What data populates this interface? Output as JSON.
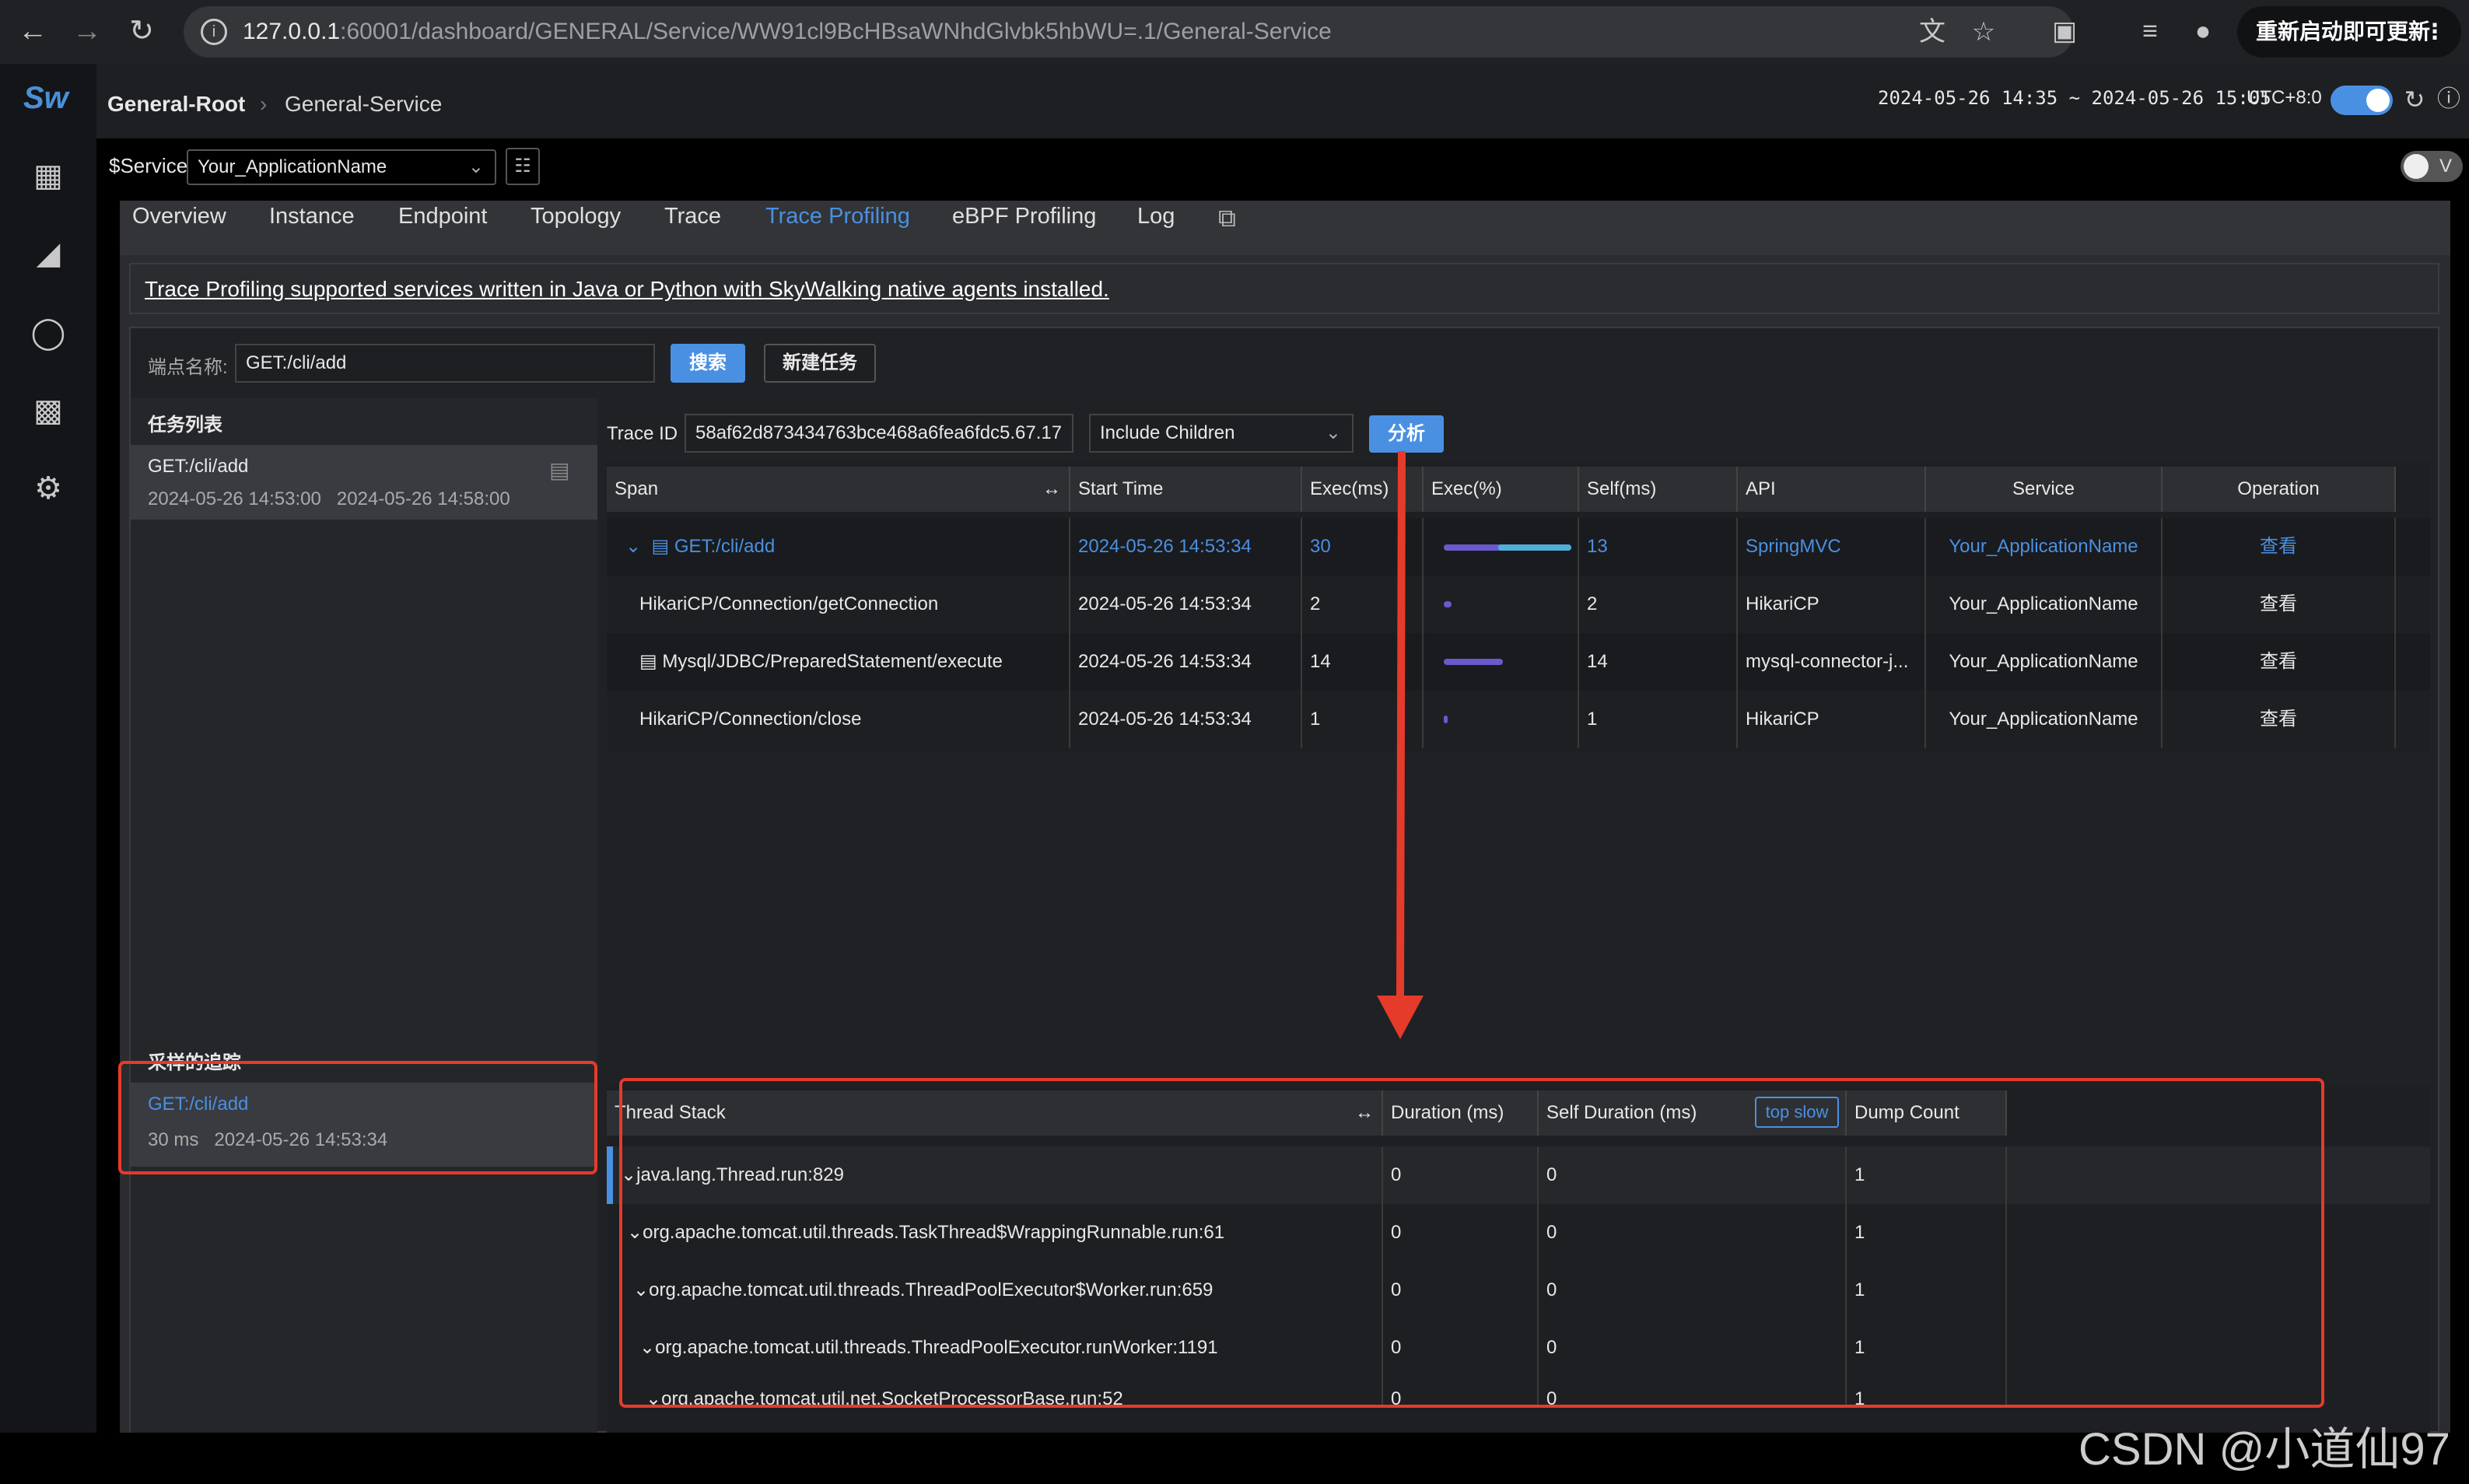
{
  "browser": {
    "url_host": "127.0.0.1",
    "url_rest": ":60001/dashboard/GENERAL/Service/WW91cl9BcHBsaWNhdGlvbk5hbWU=.1/General-Service",
    "update_button": "重新启动即可更新"
  },
  "header": {
    "logo": "Sw",
    "breadcrumb_root": "General-Root",
    "breadcrumb_current": "General-Service",
    "time_range": "2024-05-26 14:35 ~ 2024-05-26 15:05",
    "timezone": "UTC+8:0"
  },
  "service_bar": {
    "label": "$Service",
    "selected": "Your_ApplicationName",
    "toggle_label": "V"
  },
  "tabs": [
    "Overview",
    "Instance",
    "Endpoint",
    "Topology",
    "Trace",
    "Trace Profiling",
    "eBPF Profiling",
    "Log"
  ],
  "active_tab": "Trace Profiling",
  "notice": "Trace Profiling supported services written in Java or Python with SkyWalking native agents installed.",
  "search": {
    "label": "端点名称:",
    "value": "GET:/cli/add",
    "search_button": "搜索",
    "new_task_button": "新建任务"
  },
  "task_list": {
    "title": "任务列表",
    "items": [
      {
        "name": "GET:/cli/add",
        "start": "2024-05-26 14:53:00",
        "end": "2024-05-26 14:58:00"
      }
    ]
  },
  "sampled": {
    "title": "采样的追踪",
    "items": [
      {
        "name": "GET:/cli/add",
        "duration": "30 ms",
        "time": "2024-05-26 14:53:34"
      }
    ]
  },
  "trace_controls": {
    "trace_id_label": "Trace ID",
    "trace_id": "58af62d873434763bce468a6fea6fdc5.67.17",
    "children_option": "Include Children",
    "analyze_button": "分析"
  },
  "span_table": {
    "headers": [
      "Span",
      "Start Time",
      "Exec(ms)",
      "Exec(%)",
      "Self(ms)",
      "API",
      "Service",
      "Operation"
    ],
    "rows": [
      {
        "span": "GET:/cli/add",
        "start": "2024-05-26 14:53:34",
        "exec": "30",
        "exec_pct": 1.0,
        "self": "13",
        "api": "SpringMVC",
        "service": "Your_ApplicationName",
        "op": "查看"
      },
      {
        "span": "HikariCP/Connection/getConnection",
        "start": "2024-05-26 14:53:34",
        "exec": "2",
        "exec_pct": 0.066,
        "self": "2",
        "api": "HikariCP",
        "service": "Your_ApplicationName",
        "op": "查看"
      },
      {
        "span": "Mysql/JDBC/PreparedStatement/execute",
        "start": "2024-05-26 14:53:34",
        "exec": "14",
        "exec_pct": 0.466,
        "self": "14",
        "api": "mysql-connector-j...",
        "service": "Your_ApplicationName",
        "op": "查看"
      },
      {
        "span": "HikariCP/Connection/close",
        "start": "2024-05-26 14:53:34",
        "exec": "1",
        "exec_pct": 0.033,
        "self": "1",
        "api": "HikariCP",
        "service": "Your_ApplicationName",
        "op": "查看"
      }
    ]
  },
  "stack_table": {
    "headers": [
      "Thread Stack",
      "Duration (ms)",
      "Self Duration (ms)",
      "Dump Count"
    ],
    "top_slow_button": "top slow",
    "rows": [
      {
        "frame": "java.lang.Thread.run:829",
        "duration": "0",
        "self": "0",
        "count": "1"
      },
      {
        "frame": "org.apache.tomcat.util.threads.TaskThread$WrappingRunnable.run:61",
        "duration": "0",
        "self": "0",
        "count": "1"
      },
      {
        "frame": "org.apache.tomcat.util.threads.ThreadPoolExecutor$Worker.run:659",
        "duration": "0",
        "self": "0",
        "count": "1"
      },
      {
        "frame": "org.apache.tomcat.util.threads.ThreadPoolExecutor.runWorker:1191",
        "duration": "0",
        "self": "0",
        "count": "1"
      },
      {
        "frame": "org.apache.tomcat.util.net.SocketProcessorBase.run:52",
        "duration": "0",
        "self": "0",
        "count": "1"
      }
    ]
  },
  "watermark": "CSDN @小道仙97",
  "colors": {
    "accent": "#4a90e2",
    "highlight_red": "#e53b2b"
  }
}
